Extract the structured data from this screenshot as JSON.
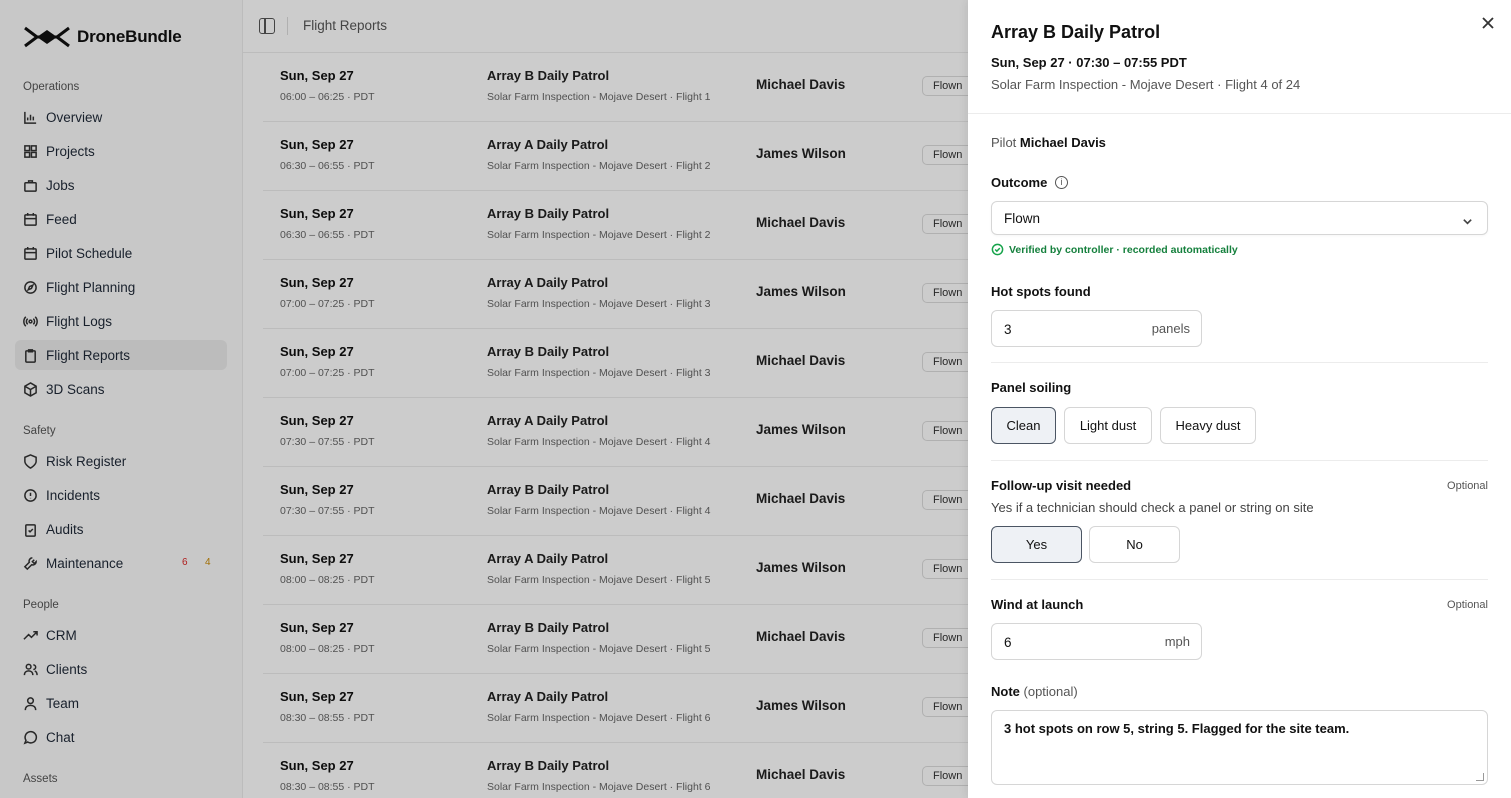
{
  "app": {
    "name": "DroneBundle"
  },
  "sidebar": {
    "groups": [
      {
        "label": "Operations",
        "items": [
          {
            "label": "Overview",
            "icon": "chart-bar-icon"
          },
          {
            "label": "Projects",
            "icon": "grid-icon"
          },
          {
            "label": "Jobs",
            "icon": "briefcase-icon"
          },
          {
            "label": "Feed",
            "icon": "calendar-icon"
          },
          {
            "label": "Pilot Schedule",
            "icon": "calendar-check-icon"
          },
          {
            "label": "Flight Planning",
            "icon": "compass-icon"
          },
          {
            "label": "Flight Logs",
            "icon": "radio-icon"
          },
          {
            "label": "Flight Reports",
            "icon": "clipboard-icon",
            "active": true
          },
          {
            "label": "3D Scans",
            "icon": "cube-icon"
          }
        ]
      },
      {
        "label": "Safety",
        "items": [
          {
            "label": "Risk Register",
            "icon": "shield-icon"
          },
          {
            "label": "Incidents",
            "icon": "alert-circle-icon"
          },
          {
            "label": "Audits",
            "icon": "clipboard-check-icon"
          },
          {
            "label": "Maintenance",
            "icon": "wrench-icon",
            "badges": [
              "6",
              "4"
            ]
          }
        ]
      },
      {
        "label": "People",
        "items": [
          {
            "label": "CRM",
            "icon": "trending-up-icon"
          },
          {
            "label": "Clients",
            "icon": "users-icon"
          },
          {
            "label": "Team",
            "icon": "user-icon"
          },
          {
            "label": "Chat",
            "icon": "message-circle-icon"
          }
        ]
      },
      {
        "label": "Assets",
        "items": []
      }
    ],
    "badge_colors": [
      "#dc2626",
      "#ca8a04"
    ]
  },
  "topbar": {
    "breadcrumb": "Flight Reports"
  },
  "rows": [
    {
      "date": "Sun, Sep 27",
      "time": "06:00 – 06:25 · PDT",
      "title": "Array B Daily Patrol",
      "sub": "Solar Farm Inspection - Mojave Desert · Flight 1",
      "pilot": "Michael Davis",
      "status": "Flown"
    },
    {
      "date": "Sun, Sep 27",
      "time": "06:30 – 06:55 · PDT",
      "title": "Array A Daily Patrol",
      "sub": "Solar Farm Inspection - Mojave Desert · Flight 2",
      "pilot": "James Wilson",
      "status": "Flown"
    },
    {
      "date": "Sun, Sep 27",
      "time": "06:30 – 06:55 · PDT",
      "title": "Array B Daily Patrol",
      "sub": "Solar Farm Inspection - Mojave Desert · Flight 2",
      "pilot": "Michael Davis",
      "status": "Flown"
    },
    {
      "date": "Sun, Sep 27",
      "time": "07:00 – 07:25 · PDT",
      "title": "Array A Daily Patrol",
      "sub": "Solar Farm Inspection - Mojave Desert · Flight 3",
      "pilot": "James Wilson",
      "status": "Flown"
    },
    {
      "date": "Sun, Sep 27",
      "time": "07:00 – 07:25 · PDT",
      "title": "Array B Daily Patrol",
      "sub": "Solar Farm Inspection - Mojave Desert · Flight 3",
      "pilot": "Michael Davis",
      "status": "Flown"
    },
    {
      "date": "Sun, Sep 27",
      "time": "07:30 – 07:55 · PDT",
      "title": "Array A Daily Patrol",
      "sub": "Solar Farm Inspection - Mojave Desert · Flight 4",
      "pilot": "James Wilson",
      "status": "Flown"
    },
    {
      "date": "Sun, Sep 27",
      "time": "07:30 – 07:55 · PDT",
      "title": "Array B Daily Patrol",
      "sub": "Solar Farm Inspection - Mojave Desert · Flight 4",
      "pilot": "Michael Davis",
      "status": "Flown"
    },
    {
      "date": "Sun, Sep 27",
      "time": "08:00 – 08:25 · PDT",
      "title": "Array A Daily Patrol",
      "sub": "Solar Farm Inspection - Mojave Desert · Flight 5",
      "pilot": "James Wilson",
      "status": "Flown"
    },
    {
      "date": "Sun, Sep 27",
      "time": "08:00 – 08:25 · PDT",
      "title": "Array B Daily Patrol",
      "sub": "Solar Farm Inspection - Mojave Desert · Flight 5",
      "pilot": "Michael Davis",
      "status": "Flown"
    },
    {
      "date": "Sun, Sep 27",
      "time": "08:30 – 08:55 · PDT",
      "title": "Array A Daily Patrol",
      "sub": "Solar Farm Inspection - Mojave Desert · Flight 6",
      "pilot": "James Wilson",
      "status": "Flown"
    },
    {
      "date": "Sun, Sep 27",
      "time": "08:30 – 08:55 · PDT",
      "title": "Array B Daily Patrol",
      "sub": "Solar Farm Inspection - Mojave Desert · Flight 6",
      "pilot": "Michael Davis",
      "status": "Flown"
    }
  ],
  "drawer": {
    "title": "Array B Daily Patrol",
    "when": "Sun, Sep 27 · 07:30 – 07:55 PDT",
    "subtitle": "Solar Farm Inspection - Mojave Desert · Flight 4 of 24",
    "pilot_label": "Pilot",
    "pilot_value": "Michael Davis",
    "outcome": {
      "label": "Outcome",
      "value": "Flown",
      "verified": "Verified by controller · recorded automatically"
    },
    "hot_spots": {
      "label": "Hot spots found",
      "value": "3",
      "unit": "panels"
    },
    "soiling": {
      "label": "Panel soiling",
      "options": [
        "Clean",
        "Light dust",
        "Heavy dust"
      ],
      "selected": "Clean"
    },
    "follow_up": {
      "label": "Follow-up visit needed",
      "optional": "Optional",
      "hint": "Yes if a technician should check a panel or string on site",
      "options": [
        "Yes",
        "No"
      ],
      "selected": "Yes"
    },
    "wind": {
      "label": "Wind at launch",
      "optional": "Optional",
      "value": "6",
      "unit": "mph"
    },
    "note": {
      "label": "Note",
      "label_suffix": "(optional)",
      "value": "3 hot spots on row 5, string 5. Flagged for the site team."
    },
    "accent_verified": "#16a34a"
  }
}
